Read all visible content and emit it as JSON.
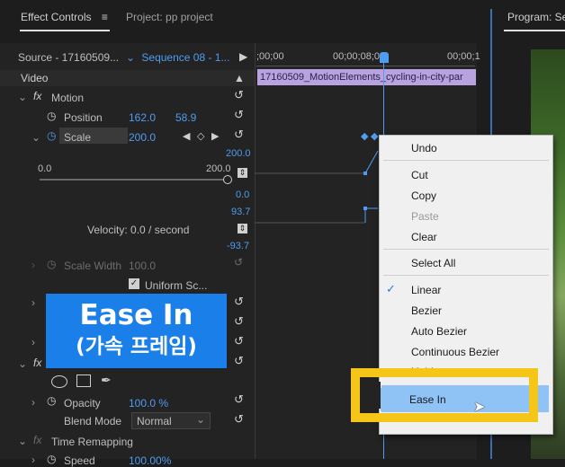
{
  "tabs": {
    "effect_controls": "Effect Controls",
    "project": "Project: pp project",
    "program": "Program: Se"
  },
  "source": {
    "source_label": "Source - 17160509...",
    "sequence_label": "Sequence 08 - 1..."
  },
  "timecodes": {
    "t1": ";00;00",
    "t2": "00;00;08;00",
    "t3": "00;00;1"
  },
  "clip_name": "17160509_MotionElements_cycling-in-city-par",
  "video_header": "Video",
  "motion": {
    "label": "Motion",
    "position": {
      "label": "Position",
      "x": "162.0",
      "y": "58.9"
    },
    "scale": {
      "label": "Scale",
      "value": "200.0"
    },
    "scale_graph": {
      "min": "0.0",
      "max": "200.0",
      "top_value": "200.0",
      "bottom_value": "0.0"
    },
    "velocity": {
      "label": "Velocity: 0.0 / second",
      "top": "93.7",
      "bottom": "-93.7"
    },
    "scale_width": {
      "label": "Scale Width",
      "value": "100.0"
    },
    "uniform_scale": "Uniform Sc..."
  },
  "overlay": {
    "line1": "Ease In",
    "line2": "(가속 프레임)"
  },
  "opacity": {
    "label": "Opacity",
    "value": "100.0 %",
    "blend_label": "Blend Mode",
    "blend_value": "Normal"
  },
  "time_remap": {
    "label": "Time Remapping",
    "speed_label": "Speed",
    "speed_value": "100.00%"
  },
  "context_menu": {
    "undo": "Undo",
    "cut": "Cut",
    "copy": "Copy",
    "paste": "Paste",
    "clear": "Clear",
    "select_all": "Select All",
    "linear": "Linear",
    "bezier": "Bezier",
    "auto_bezier": "Auto Bezier",
    "continuous_bezier": "Continuous Bezier",
    "hold": "Hold",
    "ease_in": "Ease In"
  },
  "colors": {
    "accent": "#4f9cf0",
    "overlay": "#1a7fe8",
    "highlight_frame": "#f5c518",
    "menu_selected": "#8fc3f5"
  }
}
